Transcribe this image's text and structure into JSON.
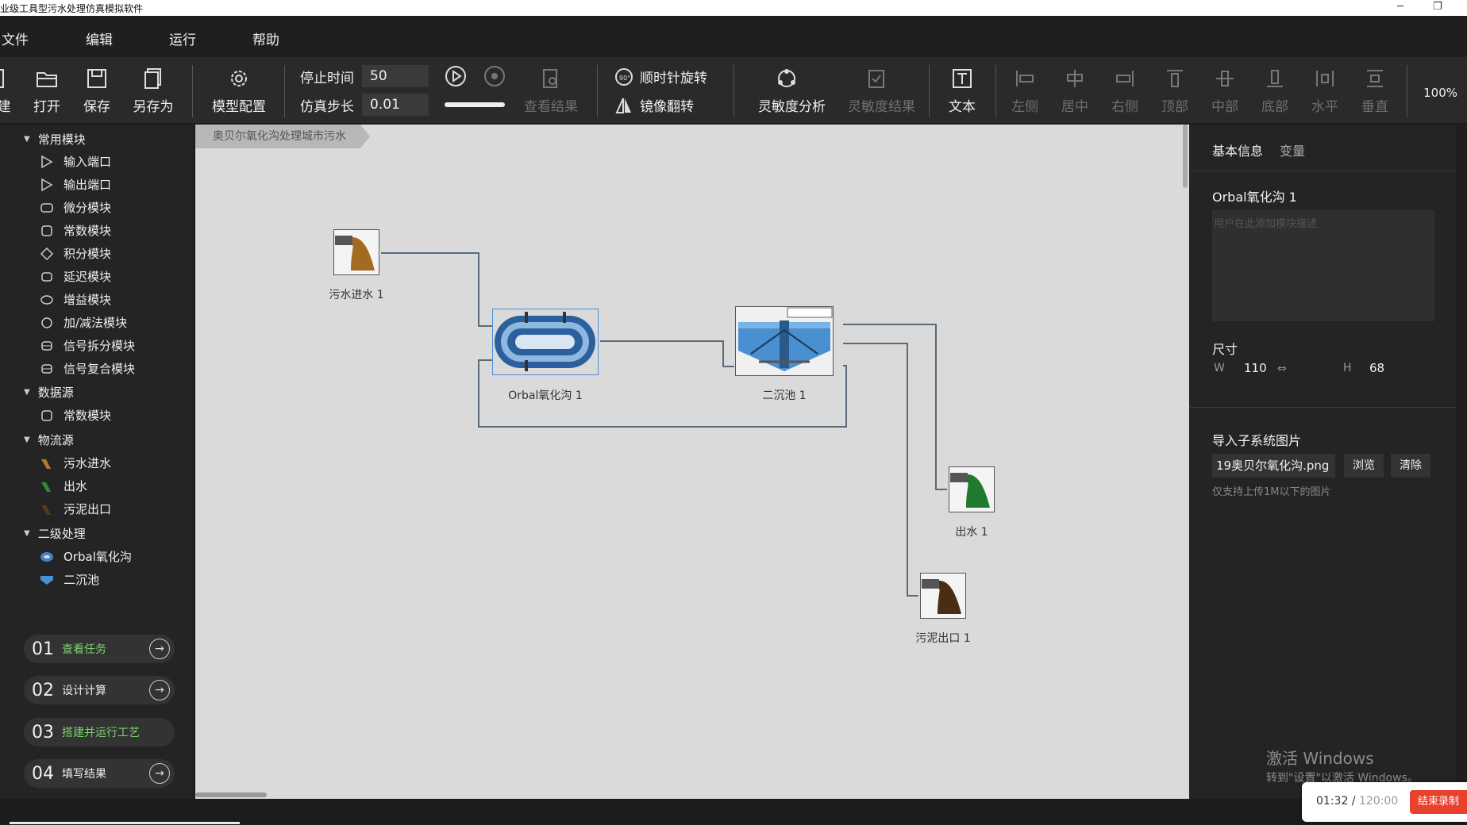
{
  "window": {
    "title": "业级工具型污水处理仿真模拟软件"
  },
  "menu": [
    "文件",
    "编辑",
    "运行",
    "帮助"
  ],
  "toolbar": {
    "new_label": "建",
    "open_label": "打开",
    "save_label": "保存",
    "saveas_label": "另存为",
    "model_config_label": "模型配置",
    "stop_time_label": "停止时间",
    "stop_time_value": "50",
    "step_label": "仿真步长",
    "step_value": "0.01",
    "view_result_label": "查看结果",
    "rotate_label": "顺时针旋转",
    "mirror_label": "镜像翻转",
    "sensitivity_label": "灵敏度分析",
    "sensitivity_result_label": "灵敏度结果",
    "text_label": "文本",
    "align": [
      "左侧",
      "居中",
      "右侧",
      "顶部",
      "中部",
      "底部",
      "水平",
      "垂直"
    ],
    "zoom": "100%"
  },
  "tree": {
    "common": {
      "label": "常用模块",
      "items": [
        "输入端口",
        "输出端口",
        "微分模块",
        "常数模块",
        "积分模块",
        "延迟模块",
        "增益模块",
        "加/减法模块",
        "信号拆分模块",
        "信号复合模块"
      ]
    },
    "datasource": {
      "label": "数据源",
      "items": [
        "常数模块"
      ]
    },
    "flowsource": {
      "label": "物流源",
      "items": [
        "污水进水",
        "出水",
        "污泥出口"
      ]
    },
    "secondary": {
      "label": "二级处理",
      "items": [
        "Orbal氧化沟",
        "二沉池"
      ]
    }
  },
  "tasks": [
    {
      "num": "01",
      "label": "查看任务"
    },
    {
      "num": "02",
      "label": "设计计算"
    },
    {
      "num": "03",
      "label": "搭建并运行工艺"
    },
    {
      "num": "04",
      "label": "填写结果"
    }
  ],
  "canvas": {
    "breadcrumb": "奥贝尔氧化沟处理城市污水",
    "blocks": {
      "inlet": "污水进水 1",
      "orbal": "Orbal氧化沟 1",
      "clarifier": "二沉池 1",
      "effluent": "出水 1",
      "sludge": "污泥出口 1"
    }
  },
  "props": {
    "tab_basic": "基本信息",
    "tab_vars": "变量",
    "name": "Orbal氧化沟 1",
    "desc_placeholder": "用户在此添加模块描述",
    "size_label": "尺寸",
    "w_label": "W",
    "w_value": "110",
    "h_label": "H",
    "h_value": "68",
    "img_label": "导入子系统图片",
    "img_file": "19奥贝尔氧化沟.png",
    "browse": "浏览",
    "clear": "清除",
    "img_hint": "仅支持上传1M以下的图片"
  },
  "watermark": {
    "line1": "激活 Windows",
    "line2": "转到\"设置\"以激活 Windows。"
  },
  "recorder": {
    "elapsed": "01:32",
    "sep": " / ",
    "total": "120:00",
    "stop": "结束录制"
  },
  "colors": {
    "accent_green": "#7ad36a",
    "record_red": "#e8422f",
    "selection_blue": "#4a90d9"
  }
}
